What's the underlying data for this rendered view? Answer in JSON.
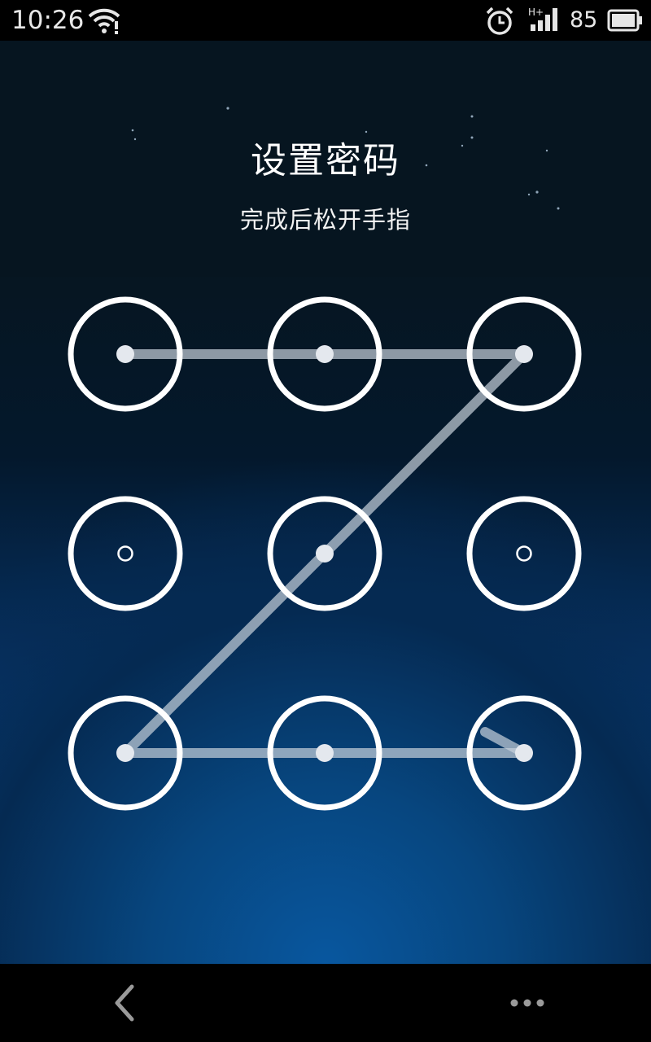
{
  "status_bar": {
    "time": "10:26",
    "battery_percent": "85",
    "icons": [
      "wifi-icon",
      "alarm-icon",
      "signal-icon",
      "battery-icon"
    ],
    "network_type": "H+"
  },
  "lock_setup": {
    "title": "设置密码",
    "subtitle": "完成后松开手指",
    "grid_size": 3,
    "pattern_sequence": [
      1,
      2,
      3,
      5,
      7,
      8,
      9
    ],
    "dots": [
      {
        "id": 1,
        "selected": true
      },
      {
        "id": 2,
        "selected": true
      },
      {
        "id": 3,
        "selected": true
      },
      {
        "id": 4,
        "selected": false
      },
      {
        "id": 5,
        "selected": true
      },
      {
        "id": 6,
        "selected": false
      },
      {
        "id": 7,
        "selected": true
      },
      {
        "id": 8,
        "selected": true
      },
      {
        "id": 9,
        "selected": true
      }
    ]
  },
  "nav_bar": {
    "back_icon": "chevron-left-icon",
    "menu_icon": "more-dots-icon"
  },
  "colors": {
    "ring": "#ffffff",
    "line": "#c8d2dc",
    "background_top": "#061520",
    "background_bottom": "#084d92"
  }
}
